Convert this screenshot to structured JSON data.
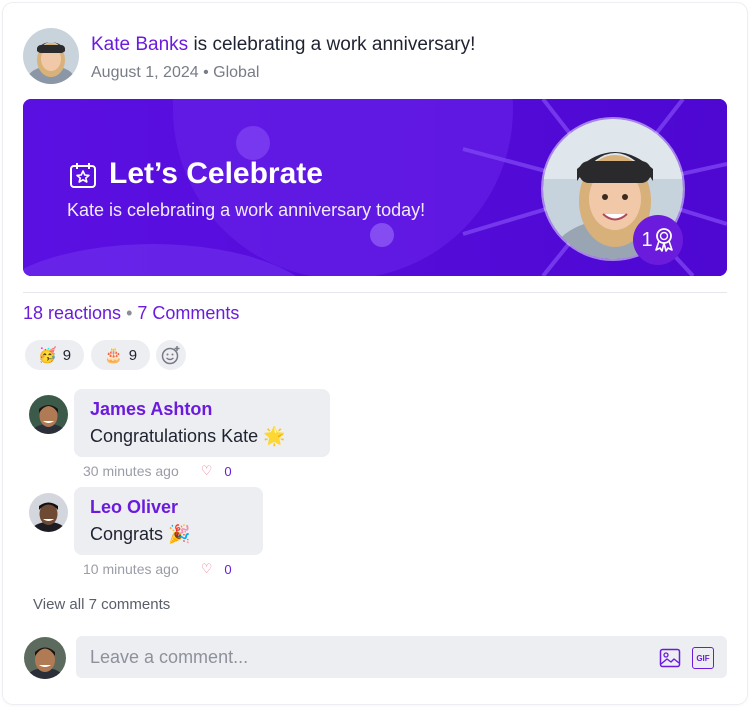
{
  "post": {
    "author": "Kate Banks",
    "action": " is celebrating a work anniversary!",
    "date": "August 1, 2024",
    "separator": " • ",
    "audience": "Global"
  },
  "banner": {
    "title": "Let’s Celebrate",
    "subtitle": "Kate is celebrating a work anniversary today!",
    "badge_number": "1",
    "background_color": "#5a0ee0"
  },
  "stats": {
    "reactions": "18 reactions",
    "separator": " • ",
    "comments": "7 Comments"
  },
  "reactions": [
    {
      "emoji": "🥳",
      "count": "9",
      "icon": "party-face-icon"
    },
    {
      "emoji": "🎂",
      "count": "9",
      "icon": "birthday-cake-icon"
    }
  ],
  "comments": [
    {
      "name": "James Ashton",
      "text": "Congratulations Kate 🌟",
      "time": "30 minutes ago",
      "likes": "0"
    },
    {
      "name": "Leo Oliver",
      "text": "Congrats 🎉",
      "time": "10 minutes ago",
      "likes": "0"
    }
  ],
  "view_all": "View all 7 comments",
  "composer": {
    "placeholder": "Leave a comment...",
    "gif_label": "GIF"
  },
  "colors": {
    "accent": "#6b1bdc",
    "bubble": "#eceef2"
  }
}
